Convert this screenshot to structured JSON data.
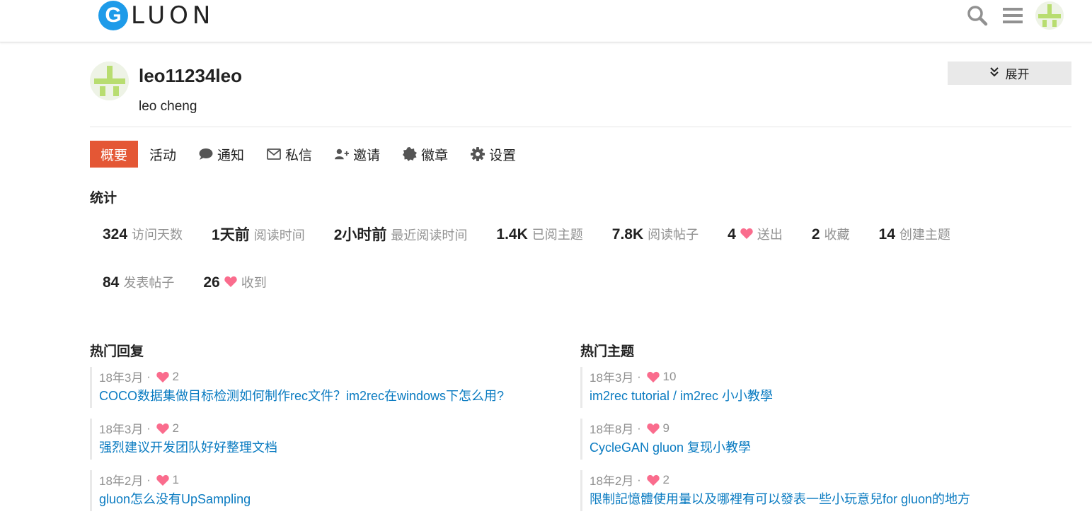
{
  "header": {
    "logo_letter": "G",
    "logo_text": "LUON",
    "icons": [
      "search-icon",
      "hamburger-menu-icon",
      "user-avatar"
    ]
  },
  "profile": {
    "username": "leo11234leo",
    "fullname": "leo cheng",
    "expand_label": "展开"
  },
  "nav": {
    "items": [
      {
        "label": "概要",
        "icon": "",
        "active": true
      },
      {
        "label": "活动",
        "icon": "",
        "active": false
      },
      {
        "label": "通知",
        "icon": "comment-icon",
        "active": false
      },
      {
        "label": "私信",
        "icon": "envelope-icon",
        "active": false
      },
      {
        "label": "邀请",
        "icon": "user-plus-icon",
        "active": false
      },
      {
        "label": "徽章",
        "icon": "badge-icon",
        "active": false
      },
      {
        "label": "设置",
        "icon": "gear-icon",
        "active": false
      }
    ]
  },
  "stats": {
    "title": "统计",
    "items": [
      {
        "value": "324",
        "label": "访问天数",
        "heart": false
      },
      {
        "value": "1天前",
        "label": "阅读时间",
        "heart": false
      },
      {
        "value": "2小时前",
        "label": "最近阅读时间",
        "heart": false
      },
      {
        "value": "1.4K",
        "label": "已阅主题",
        "heart": false
      },
      {
        "value": "7.8K",
        "label": "阅读帖子",
        "heart": false
      },
      {
        "value": "4",
        "label": "送出",
        "heart": true
      },
      {
        "value": "2",
        "label": "收藏",
        "heart": false
      },
      {
        "value": "14",
        "label": "创建主题",
        "heart": false
      },
      {
        "value": "84",
        "label": "发表帖子",
        "heart": false
      },
      {
        "value": "26",
        "label": "收到",
        "heart": true
      }
    ]
  },
  "top_replies": {
    "title": "热门回复",
    "items": [
      {
        "date": "18年3月",
        "likes": "2",
        "title": "COCO数据集做目标检测如何制作rec文件？im2rec在windows下怎么用?"
      },
      {
        "date": "18年3月",
        "likes": "2",
        "title": "强烈建议开发团队好好整理文档"
      },
      {
        "date": "18年2月",
        "likes": "1",
        "title": "gluon怎么没有UpSampling"
      }
    ]
  },
  "top_topics": {
    "title": "热门主题",
    "items": [
      {
        "date": "18年3月",
        "likes": "10",
        "title": "im2rec tutorial / im2rec 小小教學"
      },
      {
        "date": "18年8月",
        "likes": "9",
        "title": "CycleGAN gluon 复现小教學"
      },
      {
        "date": "18年2月",
        "likes": "2",
        "title": "限制記憶體使用量以及哪裡有可以發表一些小玩意兒for gluon的地方"
      }
    ]
  },
  "colors": {
    "accent": "#e45735",
    "link": "#0a7bc1",
    "heart": "#fa6c8d",
    "logo_blue": "#1e9be9",
    "muted": "#919191"
  }
}
